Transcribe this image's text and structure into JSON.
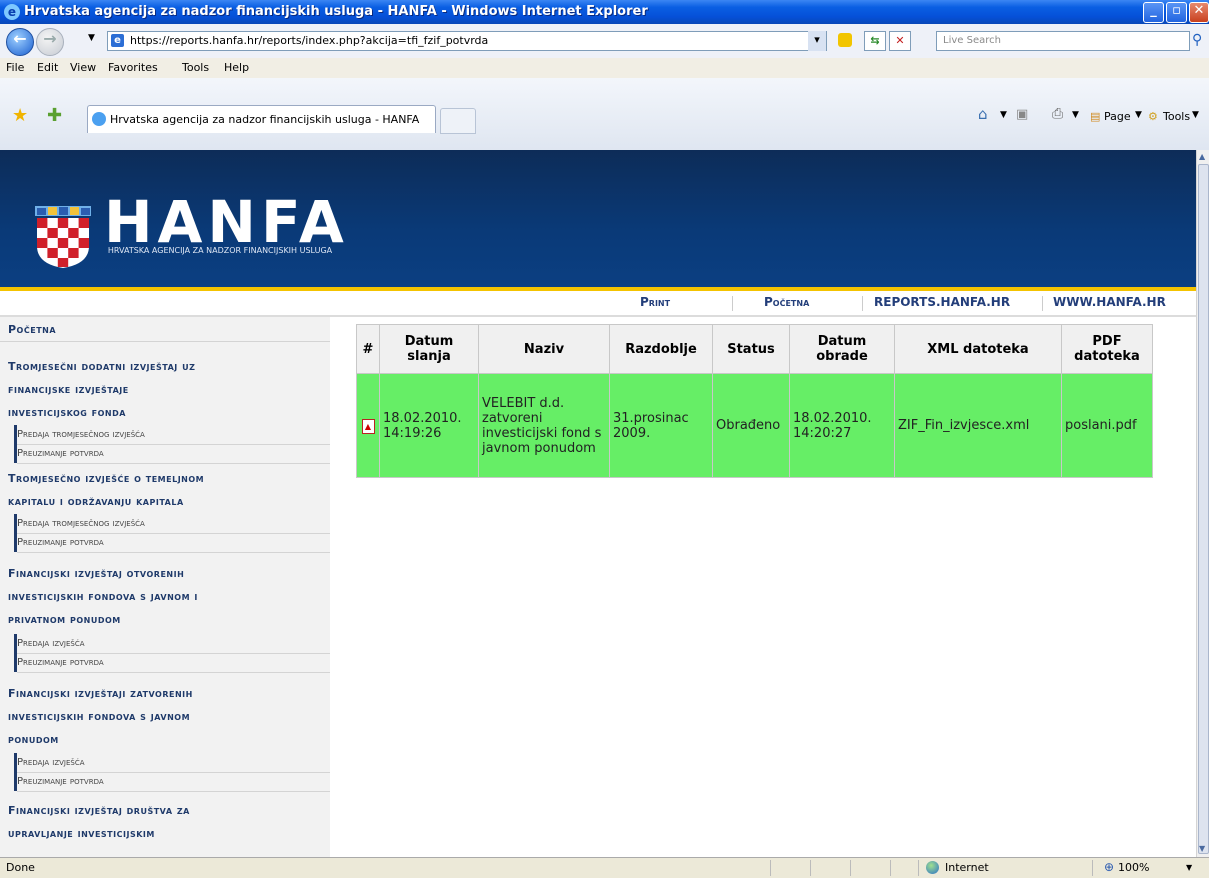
{
  "window": {
    "title": "Hrvatska agencija za nadzor financijskih usluga - HANFA - Windows Internet Explorer"
  },
  "address": {
    "url": "https://reports.hanfa.hr/reports/index.php?akcija=tfi_fzif_potvrda"
  },
  "search": {
    "placeholder": "Live Search"
  },
  "menu": {
    "items": [
      "File",
      "Edit",
      "View",
      "Favorites",
      "Tools",
      "Help"
    ]
  },
  "tab": {
    "title": "Hrvatska agencija za nadzor financijskih usluga - HANFA"
  },
  "commandbar": {
    "page_label": "Page",
    "tools_label": "Tools"
  },
  "banner": {
    "logo": "HANFA",
    "subtitle": "HRVATSKA AGENCIJA ZA NADZOR FINANCIJSKIH USLUGA"
  },
  "nav": {
    "print": "Print",
    "home": "Početna",
    "reports": "REPORTS.HANFA.HR",
    "www": "WWW.HANFA.HR"
  },
  "sidebar": {
    "home": "Početna",
    "sections": [
      {
        "lines": [
          "Tromjesečni dodatni izvještaj uz",
          "financijske izvještaje",
          "investicijskog fonda"
        ],
        "links": [
          "Predaja tromjesečnog izvješća",
          "Preuzimanje potvrda"
        ]
      },
      {
        "lines": [
          "Tromjesečno izvješće o temeljnom",
          "kapitalu i održavanju kapitala"
        ],
        "links": [
          "Predaja tromjesečnog izvješća",
          "Preuzimanje potvrda"
        ]
      },
      {
        "lines": [
          "Financijski izvještaj otvorenih",
          "investicijskih fondova s javnom i",
          "privatnom ponudom"
        ],
        "links": [
          "Predaja izvješća",
          "Preuzimanje potvrda"
        ]
      },
      {
        "lines": [
          "Financijski izvještaji zatvorenih",
          "investicijskih fondova s javnom",
          "ponudom"
        ],
        "links": [
          "Predaja izvješća",
          "Preuzimanje potvrda"
        ]
      },
      {
        "lines": [
          "Financijski izvještaj društva za",
          "upravljanje investicijskim"
        ],
        "links": []
      }
    ]
  },
  "table": {
    "headers": {
      "num": "#",
      "datum_slanja": "Datum slanja",
      "naziv": "Naziv",
      "razdoblje": "Razdoblje",
      "status": "Status",
      "datum_obrade": "Datum obrade",
      "xml": "XML datoteka",
      "pdf": "PDF datoteka"
    },
    "rows": [
      {
        "datum_slanja": "18.02.2010. 14:19:26",
        "naziv": "VELEBIT d.d. zatvoreni investicijski fond s javnom ponudom",
        "razdoblje": "31.prosinac 2009.",
        "status": "Obrađeno",
        "datum_obrade": "18.02.2010. 14:20:27",
        "xml": "ZIF_Fin_izvjesce.xml",
        "pdf": "poslani.pdf"
      }
    ]
  },
  "status": {
    "left": "Done",
    "zone": "Internet",
    "zoom": "100%"
  }
}
